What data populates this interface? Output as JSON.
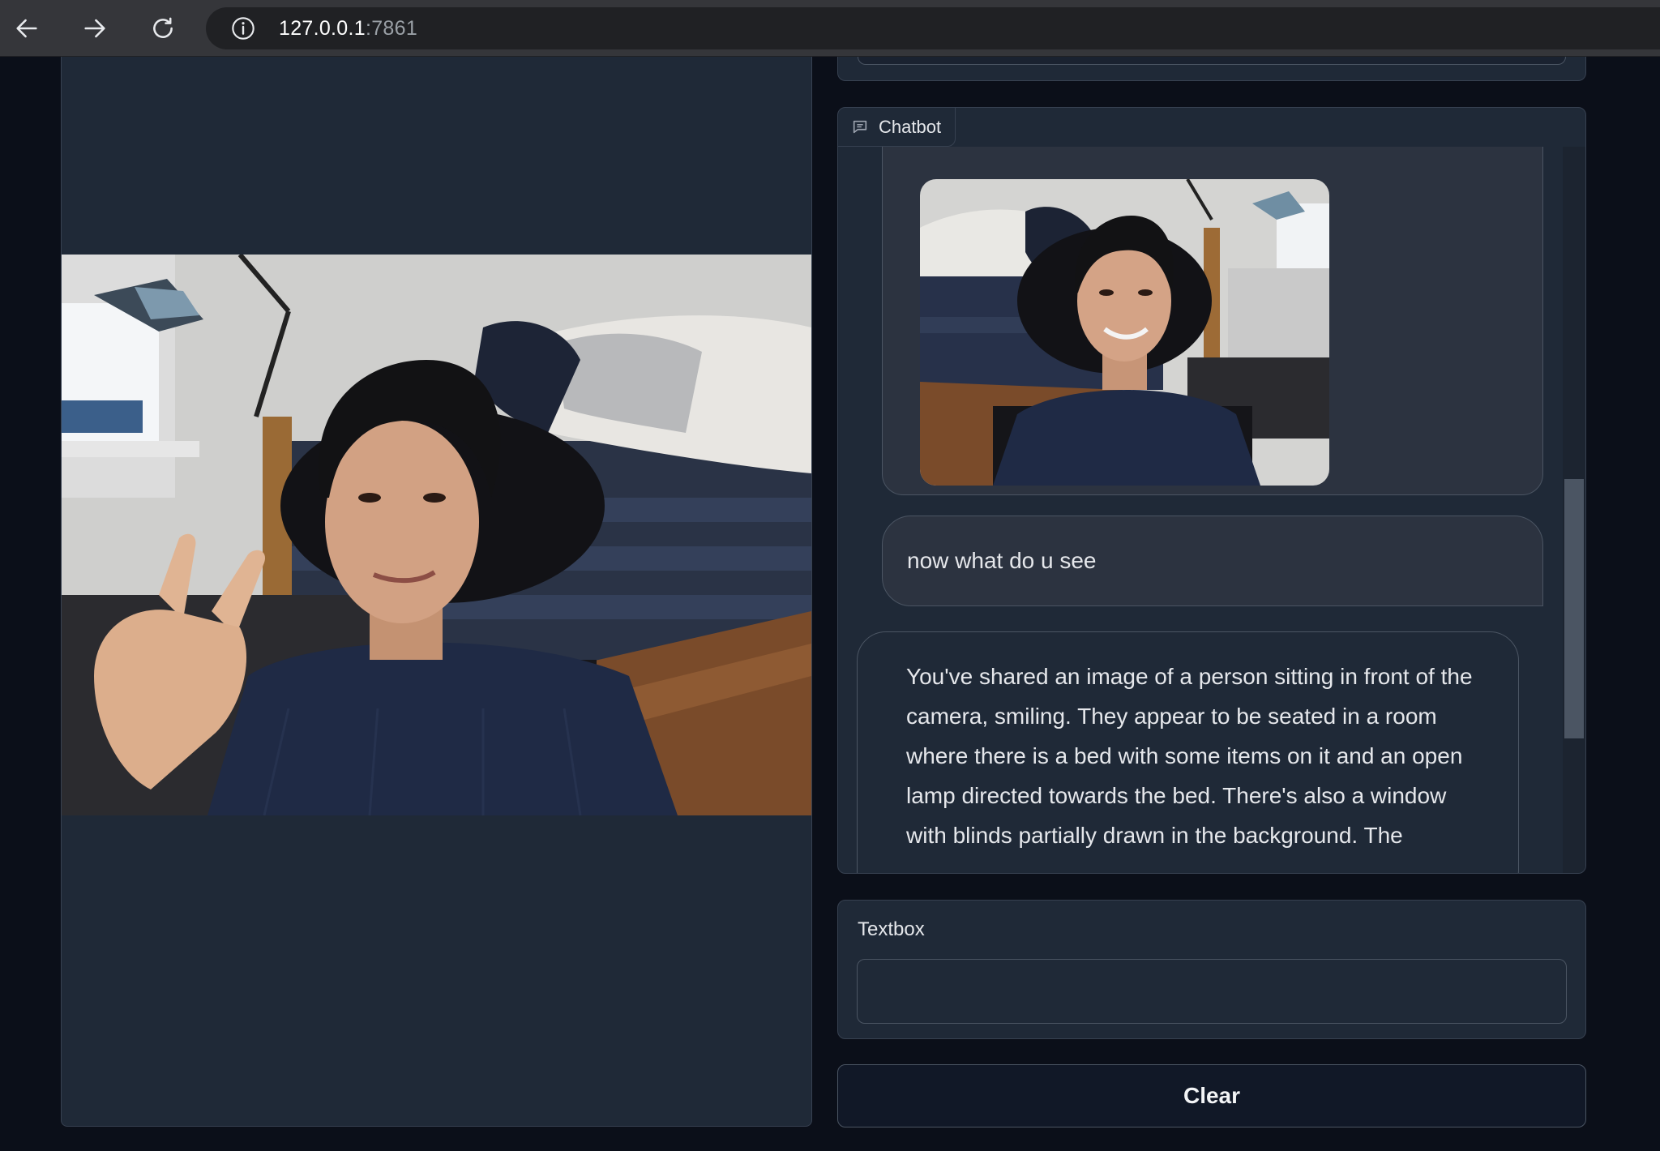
{
  "browser": {
    "url_host": "127.0.0.1",
    "url_port": ":7861"
  },
  "chatbot": {
    "label": "Chatbot",
    "messages": [
      {
        "role": "user",
        "type": "image"
      },
      {
        "role": "user",
        "type": "text",
        "text": "now what do u see"
      },
      {
        "role": "assistant",
        "type": "text",
        "text": "You've shared an image of a person sitting in front of the camera, smiling. They appear to be seated in a room where there is a bed with some items on it and an open lamp directed towards the bed. There's also a window with blinds partially drawn in the background. The"
      }
    ]
  },
  "textbox": {
    "label": "Textbox",
    "value": "",
    "placeholder": ""
  },
  "clear_label": "Clear",
  "colors": {
    "background": "#0b0f19",
    "panel": "#1f2937",
    "border": "#374151",
    "browser_bar": "#35363a"
  }
}
